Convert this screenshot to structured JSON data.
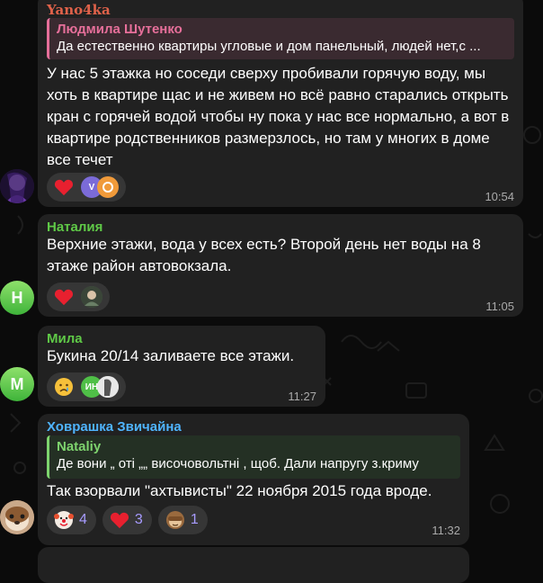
{
  "colors": {
    "bubble": "#212121",
    "reaction_pill": "#363636",
    "reaction_count": "#a79bff",
    "sender_top": "#e0624a",
    "sender_natalia": "#5fc947",
    "sender_mila": "#5fc947",
    "sender_hovrashka": "#4fb4ff",
    "reply_pink": "#e66f9a",
    "reply_green": "#7ed46e"
  },
  "messages": [
    {
      "sender": "Yano4ka",
      "reply": {
        "name": "Людмила Шутенко",
        "text": "Да естественно квартиры угловые и дом панельный, людей нет,с ..."
      },
      "text": "У нас 5 этажка но соседи сверху пробивали горячую воду, мы хоть в квартире щас и не живем но всё равно старались открыть кран с горячей водой чтобы ну пока у нас все нормально, а вот в квартире родственников размерзлось, но там у многих в доме все течет",
      "reactions": {
        "emoji": "heart-icon",
        "reactor_1_initial": "V"
      },
      "time": "10:54"
    },
    {
      "sender": "Наталия",
      "avatar_initial": "Н",
      "text": "Верхние этажи, вода у всех есть? Второй день нет воды на 8 этаже район автовокзала.",
      "reactions": {
        "emoji": "heart-icon"
      },
      "time": "11:05"
    },
    {
      "sender": "Мила",
      "avatar_initial": "М",
      "text": "Букина 20/14 заливаете все этажи.",
      "reactions": {
        "emoji": "crying-face-icon",
        "reactor_1_initial": "ИН"
      },
      "time": "11:27"
    },
    {
      "sender": "Ховрашка Звичайна",
      "reply": {
        "name": "Nataliy",
        "text": "Де вони „ оті „„ височовольтні , щоб. Дали напругу з.криму"
      },
      "text": "Так взорвали \"ахтывисты\" 22 ноября 2015 года вроде.",
      "reactions": [
        {
          "emoji": "clown-face-icon",
          "count": "4"
        },
        {
          "emoji": "heart-icon",
          "count": "3"
        },
        {
          "emoji": "see-no-evil-monkey-icon",
          "count": "1"
        }
      ],
      "time": "11:32"
    }
  ]
}
